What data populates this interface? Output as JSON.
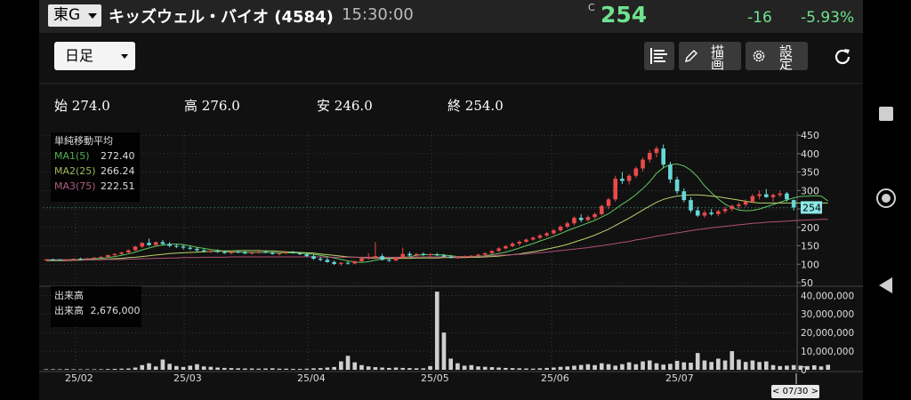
{
  "header": {
    "market_label": "東G",
    "title": "キッズウェル・バイオ (4584)",
    "time": "15:30:00",
    "price_mark": "C",
    "price": "254",
    "change": "-16",
    "change_pct": "-5.93%"
  },
  "toolbar": {
    "period_label": "日足",
    "draw_label": "描画",
    "settings_label": "設定"
  },
  "ohlc": {
    "open_label": "始",
    "open": "274.0",
    "high_label": "高",
    "high": "276.0",
    "low_label": "安",
    "low": "246.0",
    "close_label": "終",
    "close": "254.0"
  },
  "ma_panel": {
    "title": "単純移動平均",
    "rows": [
      {
        "label": "MA1(5)",
        "value": "272.40"
      },
      {
        "label": "MA2(25)",
        "value": "266.24"
      },
      {
        "label": "MA3(75)",
        "value": "222.51"
      }
    ]
  },
  "volume_panel": {
    "title": "出来高",
    "label": "出来高",
    "value": "2,676,000"
  },
  "date_badge": "< 07/30 >",
  "colors": {
    "up": "#e84a4a",
    "down": "#67d7d7",
    "ma1": "#5fc85f",
    "ma2": "#b9d46a",
    "ma3": "#b0507a",
    "volume": "#cfcfcf",
    "price_green": "#6fe38f"
  },
  "chart_data": [
    {
      "type": "candlestick",
      "title": "",
      "ylim": [
        50,
        460
      ],
      "y_ticks": [
        "450",
        "400",
        "350",
        "300",
        "250",
        "200",
        "150",
        "100",
        "50"
      ],
      "current_price_label": "254",
      "x_tick_labels": [
        "25/02",
        "25/03",
        "25/04",
        "25/05",
        "25/06",
        "25/07"
      ],
      "ohlc": [
        [
          112,
          114,
          110,
          113
        ],
        [
          113,
          115,
          111,
          112
        ],
        [
          112,
          114,
          109,
          110
        ],
        [
          110,
          113,
          108,
          112
        ],
        [
          112,
          116,
          111,
          115
        ],
        [
          115,
          118,
          113,
          114
        ],
        [
          114,
          117,
          112,
          116
        ],
        [
          116,
          119,
          114,
          118
        ],
        [
          118,
          122,
          116,
          120
        ],
        [
          120,
          126,
          118,
          125
        ],
        [
          125,
          130,
          122,
          128
        ],
        [
          128,
          134,
          126,
          132
        ],
        [
          132,
          140,
          129,
          138
        ],
        [
          138,
          150,
          136,
          148
        ],
        [
          148,
          160,
          144,
          158
        ],
        [
          158,
          170,
          150,
          152
        ],
        [
          152,
          162,
          148,
          160
        ],
        [
          160,
          166,
          152,
          155
        ],
        [
          155,
          160,
          146,
          150
        ],
        [
          150,
          156,
          144,
          148
        ],
        [
          148,
          154,
          140,
          145
        ],
        [
          145,
          150,
          138,
          142
        ],
        [
          142,
          146,
          134,
          138
        ],
        [
          138,
          142,
          132,
          135
        ],
        [
          135,
          140,
          130,
          136
        ],
        [
          136,
          140,
          131,
          133
        ],
        [
          133,
          137,
          128,
          130
        ],
        [
          130,
          135,
          127,
          134
        ],
        [
          134,
          138,
          130,
          132
        ],
        [
          132,
          136,
          128,
          129
        ],
        [
          129,
          134,
          126,
          132
        ],
        [
          132,
          136,
          129,
          134
        ],
        [
          134,
          138,
          130,
          131
        ],
        [
          131,
          134,
          126,
          128
        ],
        [
          128,
          132,
          124,
          130
        ],
        [
          130,
          134,
          127,
          133
        ],
        [
          133,
          136,
          129,
          130
        ],
        [
          130,
          133,
          125,
          127
        ],
        [
          127,
          130,
          120,
          122
        ],
        [
          122,
          126,
          112,
          115
        ],
        [
          115,
          120,
          108,
          112
        ],
        [
          112,
          118,
          104,
          106
        ],
        [
          106,
          110,
          98,
          101
        ],
        [
          101,
          106,
          96,
          104
        ],
        [
          104,
          108,
          99,
          102
        ],
        [
          102,
          110,
          100,
          108
        ],
        [
          108,
          118,
          106,
          116
        ],
        [
          116,
          130,
          112,
          118
        ],
        [
          118,
          160,
          114,
          122
        ],
        [
          122,
          128,
          110,
          112
        ],
        [
          112,
          118,
          106,
          110
        ],
        [
          110,
          120,
          108,
          118
        ],
        [
          118,
          145,
          114,
          128
        ],
        [
          128,
          134,
          120,
          124
        ],
        [
          124,
          130,
          118,
          128
        ],
        [
          128,
          132,
          122,
          125
        ],
        [
          125,
          130,
          120,
          127
        ],
        [
          127,
          131,
          122,
          124
        ],
        [
          124,
          128,
          119,
          121
        ],
        [
          121,
          125,
          116,
          118
        ],
        [
          118,
          122,
          114,
          120
        ],
        [
          120,
          124,
          116,
          121
        ],
        [
          121,
          125,
          117,
          123
        ],
        [
          123,
          128,
          120,
          126
        ],
        [
          126,
          132,
          123,
          130
        ],
        [
          130,
          138,
          127,
          136
        ],
        [
          136,
          146,
          133,
          143
        ],
        [
          143,
          152,
          140,
          149
        ],
        [
          149,
          160,
          146,
          156
        ],
        [
          156,
          165,
          151,
          161
        ],
        [
          161,
          170,
          158,
          167
        ],
        [
          167,
          176,
          164,
          172
        ],
        [
          172,
          182,
          168,
          178
        ],
        [
          178,
          188,
          174,
          184
        ],
        [
          184,
          196,
          180,
          192
        ],
        [
          192,
          206,
          188,
          202
        ],
        [
          202,
          216,
          198,
          211
        ],
        [
          211,
          230,
          206,
          226
        ],
        [
          226,
          236,
          214,
          220
        ],
        [
          220,
          232,
          216,
          228
        ],
        [
          228,
          240,
          222,
          236
        ],
        [
          236,
          262,
          232,
          258
        ],
        [
          258,
          280,
          250,
          276
        ],
        [
          276,
          340,
          270,
          332
        ],
        [
          332,
          350,
          318,
          326
        ],
        [
          326,
          345,
          316,
          340
        ],
        [
          340,
          365,
          334,
          360
        ],
        [
          360,
          390,
          352,
          384
        ],
        [
          384,
          410,
          376,
          402
        ],
        [
          402,
          420,
          390,
          414
        ],
        [
          414,
          425,
          360,
          370
        ],
        [
          370,
          378,
          320,
          330
        ],
        [
          330,
          338,
          290,
          298
        ],
        [
          298,
          306,
          268,
          274
        ],
        [
          274,
          282,
          240,
          246
        ],
        [
          246,
          256,
          228,
          232
        ],
        [
          232,
          246,
          226,
          240
        ],
        [
          240,
          250,
          232,
          236
        ],
        [
          236,
          248,
          230,
          244
        ],
        [
          244,
          256,
          238,
          250
        ],
        [
          250,
          262,
          244,
          258
        ],
        [
          258,
          268,
          250,
          262
        ],
        [
          262,
          276,
          256,
          270
        ],
        [
          270,
          290,
          266,
          285
        ],
        [
          285,
          300,
          276,
          290
        ],
        [
          290,
          304,
          280,
          282
        ],
        [
          282,
          292,
          270,
          288
        ],
        [
          288,
          300,
          282,
          292
        ],
        [
          292,
          296,
          270,
          276
        ],
        [
          274,
          276,
          246,
          254
        ]
      ],
      "ma_series": [
        {
          "name": "MA1(5)",
          "values": [
            112,
            112,
            112,
            112,
            112,
            113,
            114,
            115,
            116,
            118,
            121,
            124,
            128,
            133,
            139,
            144,
            149,
            152,
            154,
            155,
            153,
            150,
            146,
            143,
            140,
            138,
            135,
            133,
            133,
            133,
            132,
            132,
            132,
            132,
            131,
            131,
            131,
            130,
            129,
            127,
            124,
            121,
            117,
            113,
            109,
            106,
            105,
            107,
            111,
            114,
            116,
            117,
            119,
            120,
            124,
            126,
            126,
            126,
            125,
            123,
            121,
            120,
            120,
            121,
            123,
            126,
            129,
            133,
            138,
            144,
            150,
            156,
            163,
            169,
            176,
            183,
            191,
            198,
            205,
            212,
            219,
            228,
            237,
            250,
            263,
            275,
            289,
            305,
            324,
            347,
            362,
            370,
            372,
            367,
            355,
            337,
            313,
            294,
            277,
            263,
            253,
            247,
            245,
            246,
            250,
            256,
            262,
            268,
            274,
            280,
            284,
            285,
            286,
            285,
            272
          ]
        },
        {
          "name": "MA2(25)",
          "values": [
            110,
            110,
            110,
            110,
            111,
            111,
            112,
            112,
            113,
            114,
            115,
            116,
            118,
            119,
            121,
            123,
            125,
            127,
            129,
            130,
            131,
            132,
            133,
            134,
            135,
            135,
            136,
            136,
            137,
            137,
            137,
            137,
            136,
            136,
            135,
            134,
            133,
            132,
            131,
            130,
            128,
            126,
            124,
            122,
            120,
            119,
            118,
            117,
            117,
            117,
            116,
            116,
            116,
            116,
            117,
            117,
            117,
            117,
            118,
            118,
            118,
            118,
            119,
            119,
            120,
            121,
            122,
            124,
            126,
            128,
            131,
            134,
            137,
            141,
            145,
            149,
            154,
            160,
            166,
            172,
            179,
            187,
            195,
            205,
            215,
            225,
            236,
            247,
            258,
            268,
            276,
            281,
            285,
            287,
            288,
            288,
            287,
            285,
            283,
            280,
            277,
            274,
            271,
            268,
            266,
            266,
            266,
            266,
            266,
            266,
            266,
            266,
            266,
            266,
            266
          ]
        },
        {
          "name": "MA3(75)",
          "values": [
            112,
            112,
            112,
            112,
            112,
            112,
            112,
            112,
            112,
            113,
            113,
            113,
            114,
            114,
            115,
            115,
            116,
            116,
            117,
            117,
            118,
            118,
            118,
            119,
            119,
            119,
            119,
            120,
            120,
            120,
            120,
            120,
            120,
            120,
            120,
            120,
            120,
            120,
            120,
            120,
            120,
            119,
            119,
            119,
            119,
            119,
            119,
            119,
            119,
            119,
            119,
            119,
            119,
            119,
            119,
            120,
            120,
            120,
            120,
            120,
            121,
            121,
            121,
            122,
            122,
            123,
            124,
            125,
            126,
            127,
            128,
            130,
            131,
            133,
            135,
            137,
            139,
            141,
            143,
            145,
            148,
            150,
            153,
            156,
            159,
            162,
            166,
            169,
            172,
            176,
            179,
            182,
            185,
            188,
            191,
            194,
            196,
            199,
            201,
            203,
            205,
            207,
            209,
            211,
            212,
            214,
            215,
            216,
            217,
            218,
            219,
            220,
            221,
            222,
            222
          ]
        }
      ]
    },
    {
      "type": "bar",
      "title": "出来高",
      "ylim": [
        0,
        43000000
      ],
      "y_ticks": [
        "40,000,000",
        "30,000,000",
        "20,000,000",
        "10,000,000",
        "0"
      ],
      "values": [
        300000,
        300000,
        300000,
        400000,
        300000,
        300000,
        300000,
        300000,
        300000,
        400000,
        500000,
        600000,
        700000,
        1200000,
        2500000,
        3500000,
        1800000,
        5500000,
        3200000,
        2000000,
        1500000,
        2200000,
        3000000,
        1800000,
        1600000,
        1200000,
        1000000,
        900000,
        800000,
        700000,
        700000,
        600000,
        700000,
        800000,
        600000,
        600000,
        500000,
        500000,
        600000,
        800000,
        900000,
        1200000,
        1500000,
        4500000,
        7500000,
        4000000,
        2500000,
        1800000,
        1400000,
        1200000,
        1000000,
        1200000,
        1000000,
        900000,
        800000,
        800000,
        2000000,
        42000000,
        20000000,
        6000000,
        3500000,
        2200000,
        2500000,
        1800000,
        1600000,
        1400000,
        1200000,
        1000000,
        900000,
        800000,
        700000,
        600000,
        800000,
        1000000,
        1200000,
        1600000,
        1800000,
        2200000,
        2600000,
        3000000,
        2500000,
        3500000,
        3000000,
        2200000,
        3000000,
        4000000,
        3000000,
        4500000,
        5000000,
        3500000,
        2800000,
        3200000,
        4800000,
        4000000,
        3800000,
        9000000,
        5000000,
        4200000,
        6000000,
        5000000,
        10000000,
        5500000,
        4200000,
        5000000,
        4200000,
        4500000,
        2500000,
        2000000,
        2200000,
        2500000,
        2200000,
        2000000,
        2400000,
        1800000,
        2676000
      ]
    }
  ]
}
